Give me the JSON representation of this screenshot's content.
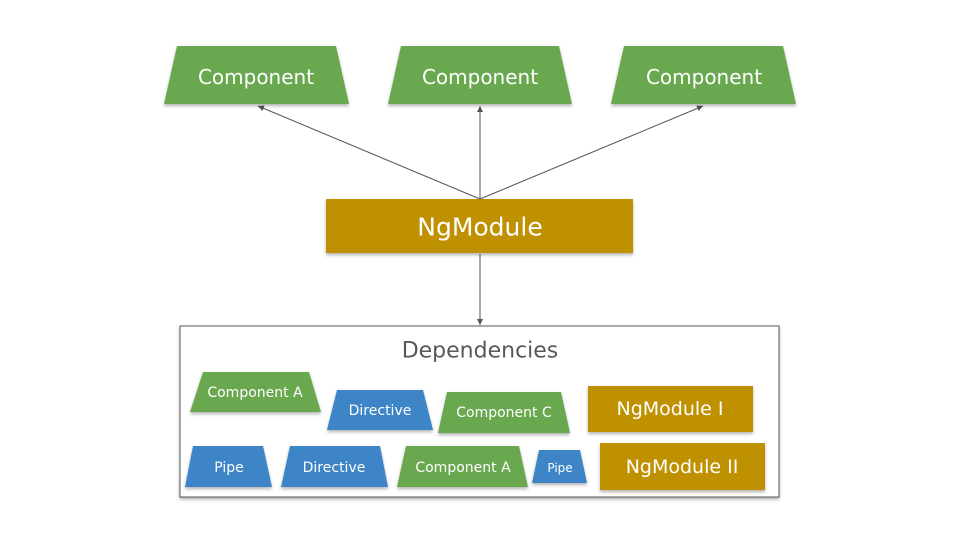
{
  "colors": {
    "component": "#6aa84f",
    "directive": "#3d85c6",
    "pipe": "#3d85c6",
    "ngmodule": "#bf9000",
    "arrow": "#555555",
    "box_border": "#595959",
    "title_text": "#595959"
  },
  "top_components": [
    {
      "label": "Component"
    },
    {
      "label": "Component"
    },
    {
      "label": "Component"
    }
  ],
  "root_module": {
    "label": "NgModule"
  },
  "dependencies": {
    "title": "Dependencies",
    "row1": [
      {
        "label": "Component A",
        "kind": "component"
      },
      {
        "label": "Directive",
        "kind": "directive"
      },
      {
        "label": "Component C",
        "kind": "component"
      },
      {
        "label": "NgModule I",
        "kind": "ngmodule"
      }
    ],
    "row2": [
      {
        "label": "Pipe",
        "kind": "pipe"
      },
      {
        "label": "Directive",
        "kind": "directive"
      },
      {
        "label": "Component A",
        "kind": "component"
      },
      {
        "label": "Pipe",
        "kind": "pipe"
      },
      {
        "label": "NgModule II",
        "kind": "ngmodule"
      }
    ]
  }
}
